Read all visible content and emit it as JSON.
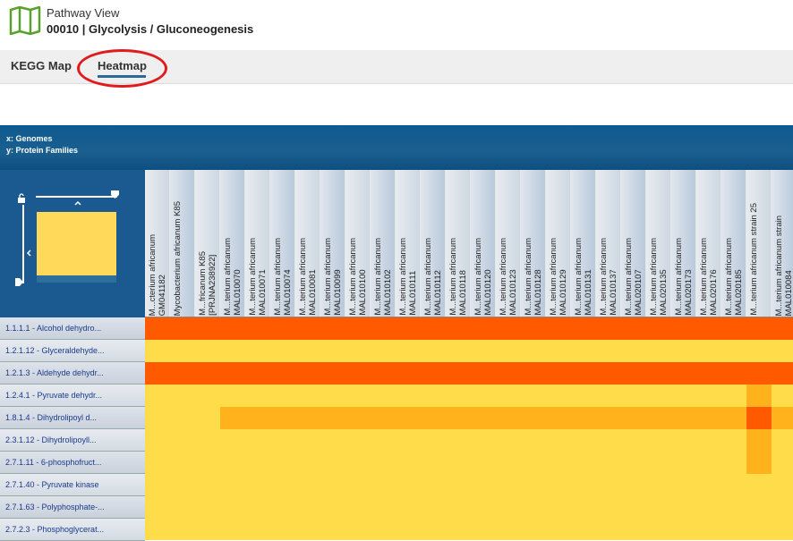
{
  "header": {
    "label": "Pathway View",
    "title": "00010 | Glycolysis / Gluconeogenesis",
    "icon": "map-icon",
    "icon_color": "#5aa02c"
  },
  "tabs": [
    {
      "label": "KEGG Map",
      "active": false
    },
    {
      "label": "Heatmap",
      "active": true
    }
  ],
  "axes": {
    "x": "x: Genomes",
    "y": "y: Protein Families"
  },
  "columns": [
    "M...cterium africanum\nGM041182",
    "Mycobacterium africanum K85",
    "M...fricanum K85\n[PRJNA238922]",
    "M...terium africanum\nMAL010070",
    "M...terium africanum\nMAL010071",
    "M...terium africanum\nMAL010074",
    "M...terium africanum\nMAL010081",
    "M...terium africanum\nMAL010099",
    "M...terium africanum\nMAL010100",
    "M...terium africanum\nMAL010102",
    "M...terium africanum\nMAL010111",
    "M...terium africanum\nMAL010112",
    "M...terium africanum\nMAL010118",
    "M...terium africanum\nMAL010120",
    "M...terium africanum\nMAL010123",
    "M...terium africanum\nMAL010128",
    "M...terium africanum\nMAL010129",
    "M...terium africanum\nMAL010131",
    "M...terium africanum\nMAL010137",
    "M...terium africanum\nMAL020107",
    "M...terium africanum\nMAL020135",
    "M...terium africanum\nMAL020173",
    "M...terium africanum\nMAL020176",
    "M...terium africanum\nMAL020185",
    "M...terium africanum strain 25",
    "M...terium africanum strain\nMAL010084"
  ],
  "rows": [
    "1.1.1.1 - Alcohol dehydro...",
    "1.2.1.12 - Glyceraldehyde...",
    "1.2.1.3 - Aldehyde dehydr...",
    "1.2.4.1 - Pyruvate dehydr...",
    "1.8.1.4 - Dihydrolipoyl d...",
    "2.3.1.12 - Dihydrolipoyll...",
    "2.7.1.11 - 6-phosphofruct...",
    "2.7.1.40 - Pyruvate kinase",
    "2.7.1.63 - Polyphosphate-...",
    "2.7.2.3 - Phosphoglycerat..."
  ],
  "palette": {
    "0": "#ffdc4a",
    "1": "#ffb21c",
    "2": "#ff8a14",
    "3": "#ff5a00"
  },
  "matrix": [
    [
      3,
      3,
      3,
      3,
      3,
      3,
      3,
      3,
      3,
      3,
      3,
      3,
      3,
      3,
      3,
      3,
      3,
      3,
      3,
      3,
      3,
      3,
      3,
      3,
      3,
      3
    ],
    [
      0,
      0,
      0,
      0,
      0,
      0,
      0,
      0,
      0,
      0,
      0,
      0,
      0,
      0,
      0,
      0,
      0,
      0,
      0,
      0,
      0,
      0,
      0,
      0,
      0,
      0
    ],
    [
      3,
      3,
      3,
      3,
      3,
      3,
      3,
      3,
      3,
      3,
      3,
      3,
      3,
      3,
      3,
      3,
      3,
      3,
      3,
      3,
      3,
      3,
      3,
      3,
      3,
      3
    ],
    [
      0,
      0,
      0,
      0,
      0,
      0,
      0,
      0,
      0,
      0,
      0,
      0,
      0,
      0,
      0,
      0,
      0,
      0,
      0,
      0,
      0,
      0,
      0,
      0,
      1,
      0
    ],
    [
      0,
      0,
      0,
      1,
      1,
      1,
      1,
      1,
      1,
      1,
      1,
      1,
      1,
      1,
      1,
      1,
      1,
      1,
      1,
      1,
      1,
      1,
      1,
      1,
      3,
      1
    ],
    [
      0,
      0,
      0,
      0,
      0,
      0,
      0,
      0,
      0,
      0,
      0,
      0,
      0,
      0,
      0,
      0,
      0,
      0,
      0,
      0,
      0,
      0,
      0,
      0,
      1,
      0
    ],
    [
      0,
      0,
      0,
      0,
      0,
      0,
      0,
      0,
      0,
      0,
      0,
      0,
      0,
      0,
      0,
      0,
      0,
      0,
      0,
      0,
      0,
      0,
      0,
      0,
      1,
      0
    ],
    [
      0,
      0,
      0,
      0,
      0,
      0,
      0,
      0,
      0,
      0,
      0,
      0,
      0,
      0,
      0,
      0,
      0,
      0,
      0,
      0,
      0,
      0,
      0,
      0,
      0,
      0
    ],
    [
      0,
      0,
      0,
      0,
      0,
      0,
      0,
      0,
      0,
      0,
      0,
      0,
      0,
      0,
      0,
      0,
      0,
      0,
      0,
      0,
      0,
      0,
      0,
      0,
      0,
      0
    ],
    [
      0,
      0,
      0,
      0,
      0,
      0,
      0,
      0,
      0,
      0,
      0,
      0,
      0,
      0,
      0,
      0,
      0,
      0,
      0,
      0,
      0,
      0,
      0,
      0,
      0,
      0
    ]
  ]
}
